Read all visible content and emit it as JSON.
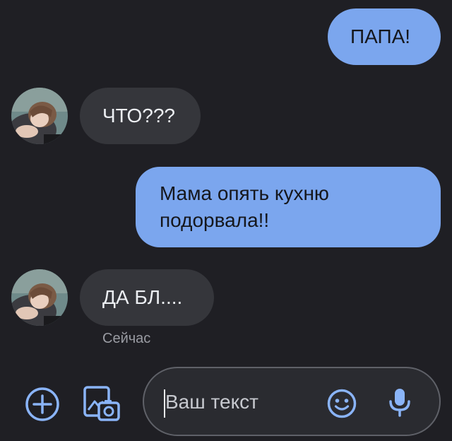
{
  "colors": {
    "background": "#1f1f24",
    "outgoing_bubble": "#7ba6ee",
    "incoming_bubble": "#35363b",
    "accent_icon": "#8ab4f8",
    "timestamp": "#9a9ca3"
  },
  "messages": [
    {
      "direction": "outgoing",
      "text": "ПАПА!"
    },
    {
      "direction": "incoming",
      "text": "ЧТО???",
      "avatar": "contact-avatar"
    },
    {
      "direction": "outgoing",
      "lines": [
        "Мама опять кухню",
        "подорвала!!"
      ]
    },
    {
      "direction": "incoming",
      "text": "ДА БЛ....",
      "avatar": "contact-avatar"
    }
  ],
  "last_message_time": "Сейчас",
  "composer": {
    "placeholder": "Ваш текст",
    "icons": [
      "add-circle-icon",
      "gallery-icon",
      "emoji-icon",
      "mic-icon"
    ]
  }
}
